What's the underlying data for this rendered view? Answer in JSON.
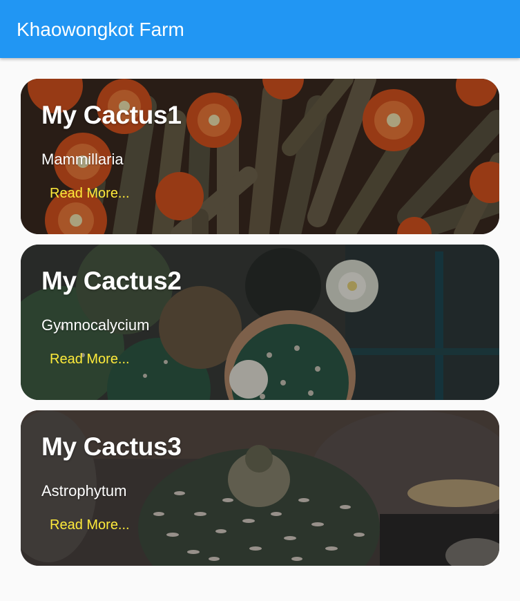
{
  "appbar": {
    "title": "Khaowongkot Farm"
  },
  "cards": [
    {
      "title": "My Cactus1",
      "subtitle": "Mammillaria",
      "button": "Read More...",
      "photo": "cactus-mammillaria-photo"
    },
    {
      "title": "My Cactus2",
      "subtitle": "Gymnocalycium",
      "button": "Read More...",
      "photo": "cactus-gymnocalycium-photo"
    },
    {
      "title": "My Cactus3",
      "subtitle": "Astrophytum",
      "button": "Read More...",
      "photo": "cactus-astrophytum-photo"
    }
  ],
  "colors": {
    "appbar": "#2196f3",
    "background": "#fafafa",
    "title_text": "#ffffff",
    "button_text": "#ffeb3b"
  }
}
